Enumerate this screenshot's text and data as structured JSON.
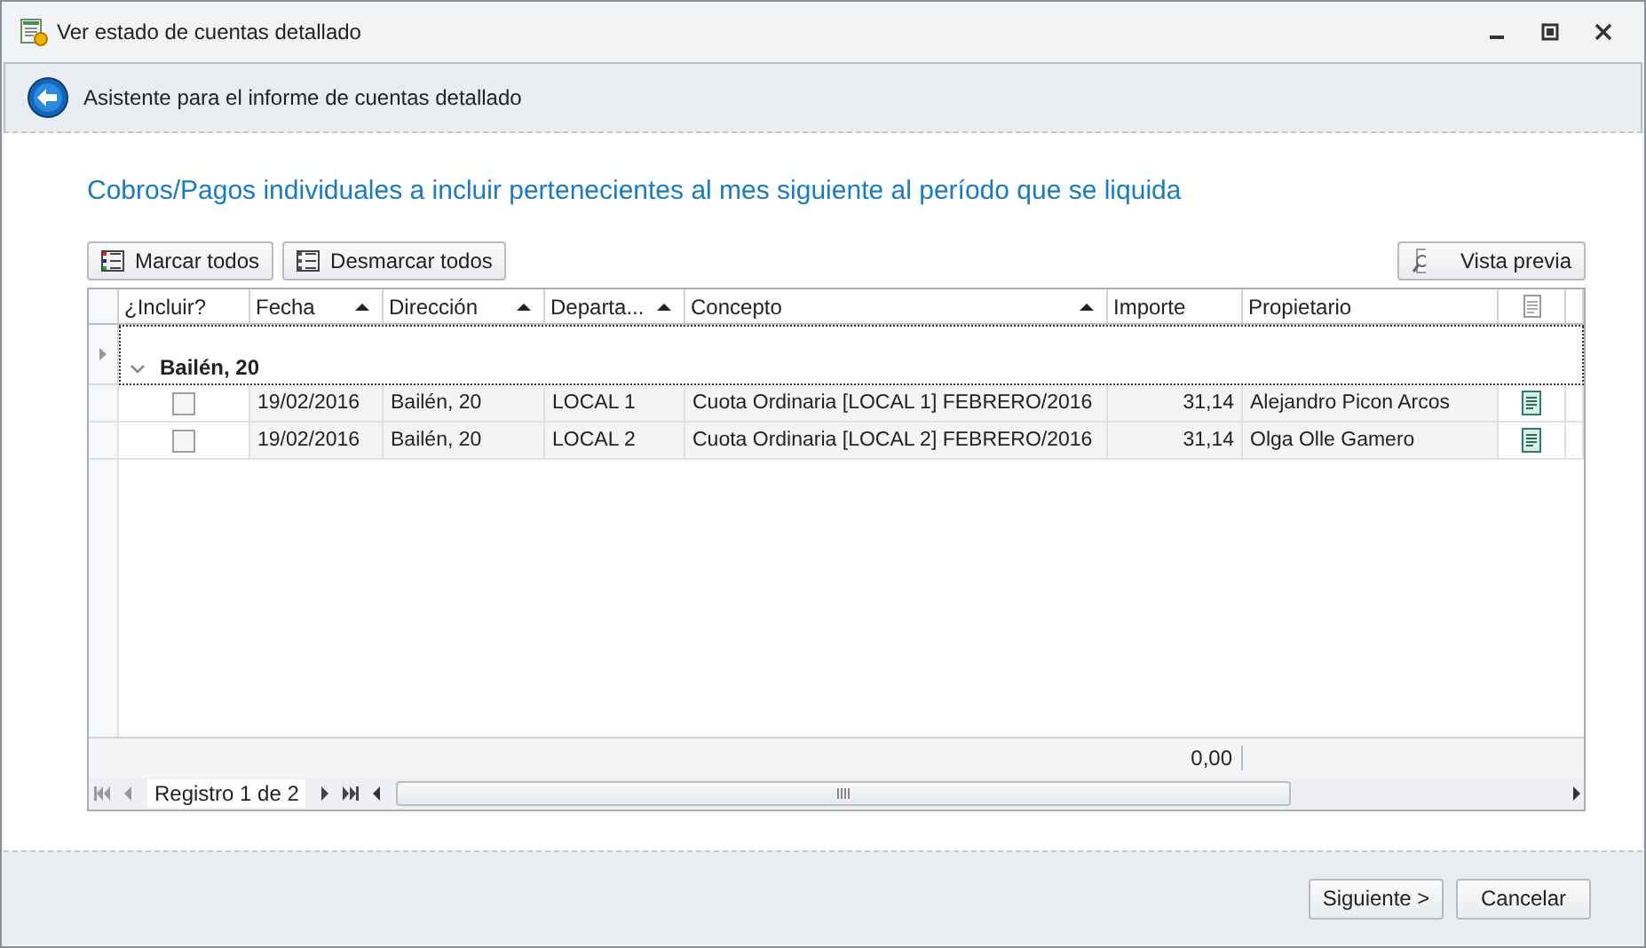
{
  "window": {
    "title": "Ver estado de cuentas detallado"
  },
  "wizard": {
    "title": "Asistente para el informe de cuentas detallado"
  },
  "heading": "Cobros/Pagos individuales a incluir pertenecientes al mes siguiente al período que se liquida",
  "toolbar": {
    "left": [
      "Marcar todos",
      "Desmarcar todos"
    ],
    "right": "Vista previa"
  },
  "grid": {
    "include_column": {
      "label": "¿Incluir?",
      "sorted": false
    },
    "columns": [
      {
        "label": "Fecha",
        "sorted": true
      },
      {
        "label": "Dirección",
        "sorted": true
      },
      {
        "label": "Departa...",
        "sorted": true
      },
      {
        "label": "Concepto",
        "sorted": true
      },
      {
        "label": "Importe",
        "sorted": false
      },
      {
        "label": "Propietario",
        "sorted": false
      }
    ],
    "group": {
      "label": "Bailén, 20",
      "expanded": true
    },
    "rows": [
      {
        "included": false,
        "cells": [
          "19/02/2016",
          "Bailén, 20",
          "LOCAL 1",
          "Cuota Ordinaria [LOCAL 1] FEBRERO/2016",
          "31,14",
          "Alejandro Picon Arcos"
        ]
      },
      {
        "included": false,
        "cells": [
          "19/02/2016",
          "Bailén, 20",
          "LOCAL 2",
          "Cuota Ordinaria [LOCAL 2] FEBRERO/2016",
          "31,14",
          "Olga Olle Gamero"
        ]
      }
    ],
    "total": "0,00",
    "navigator": "Registro 1 de 2"
  },
  "buttons": [
    "Siguiente >",
    "Cancelar"
  ]
}
